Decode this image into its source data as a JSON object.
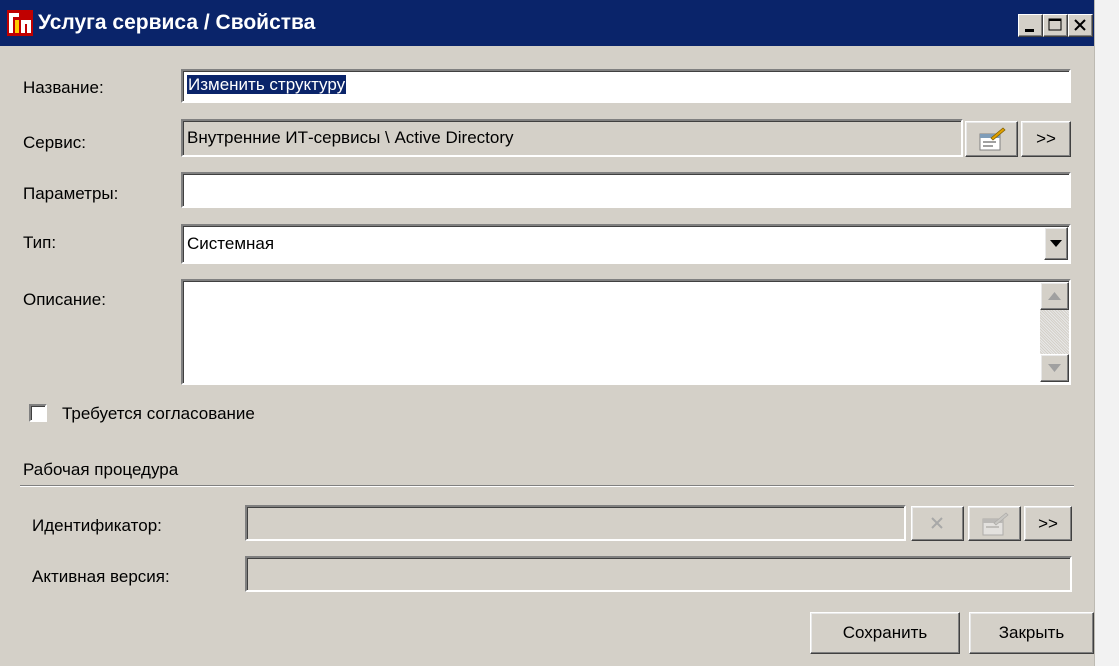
{
  "window": {
    "title": "Услуга сервиса / Свойства",
    "title_bg": "#0a246a",
    "controls": [
      "minimize-icon",
      "maximize-icon",
      "close-icon"
    ]
  },
  "form": {
    "name_label": "Название:",
    "name_value": "Изменить структуру",
    "service_label": "Сервис:",
    "service_value": "Внутренние ИТ-сервисы \\ Active Directory",
    "service_more": ">>",
    "params_label": "Параметры:",
    "params_value": "",
    "type_label": "Тип:",
    "type_value": "Системная",
    "description_label": "Описание:",
    "description_value": "",
    "approval_label": "Требуется согласование",
    "approval_checked": false
  },
  "procedure": {
    "section_title": "Рабочая процедура",
    "id_label": "Идентификатор:",
    "id_value": "",
    "id_more": ">>",
    "version_label": "Активная версия:",
    "version_value": ""
  },
  "actions": {
    "save": "Сохранить",
    "close": "Закрыть"
  }
}
